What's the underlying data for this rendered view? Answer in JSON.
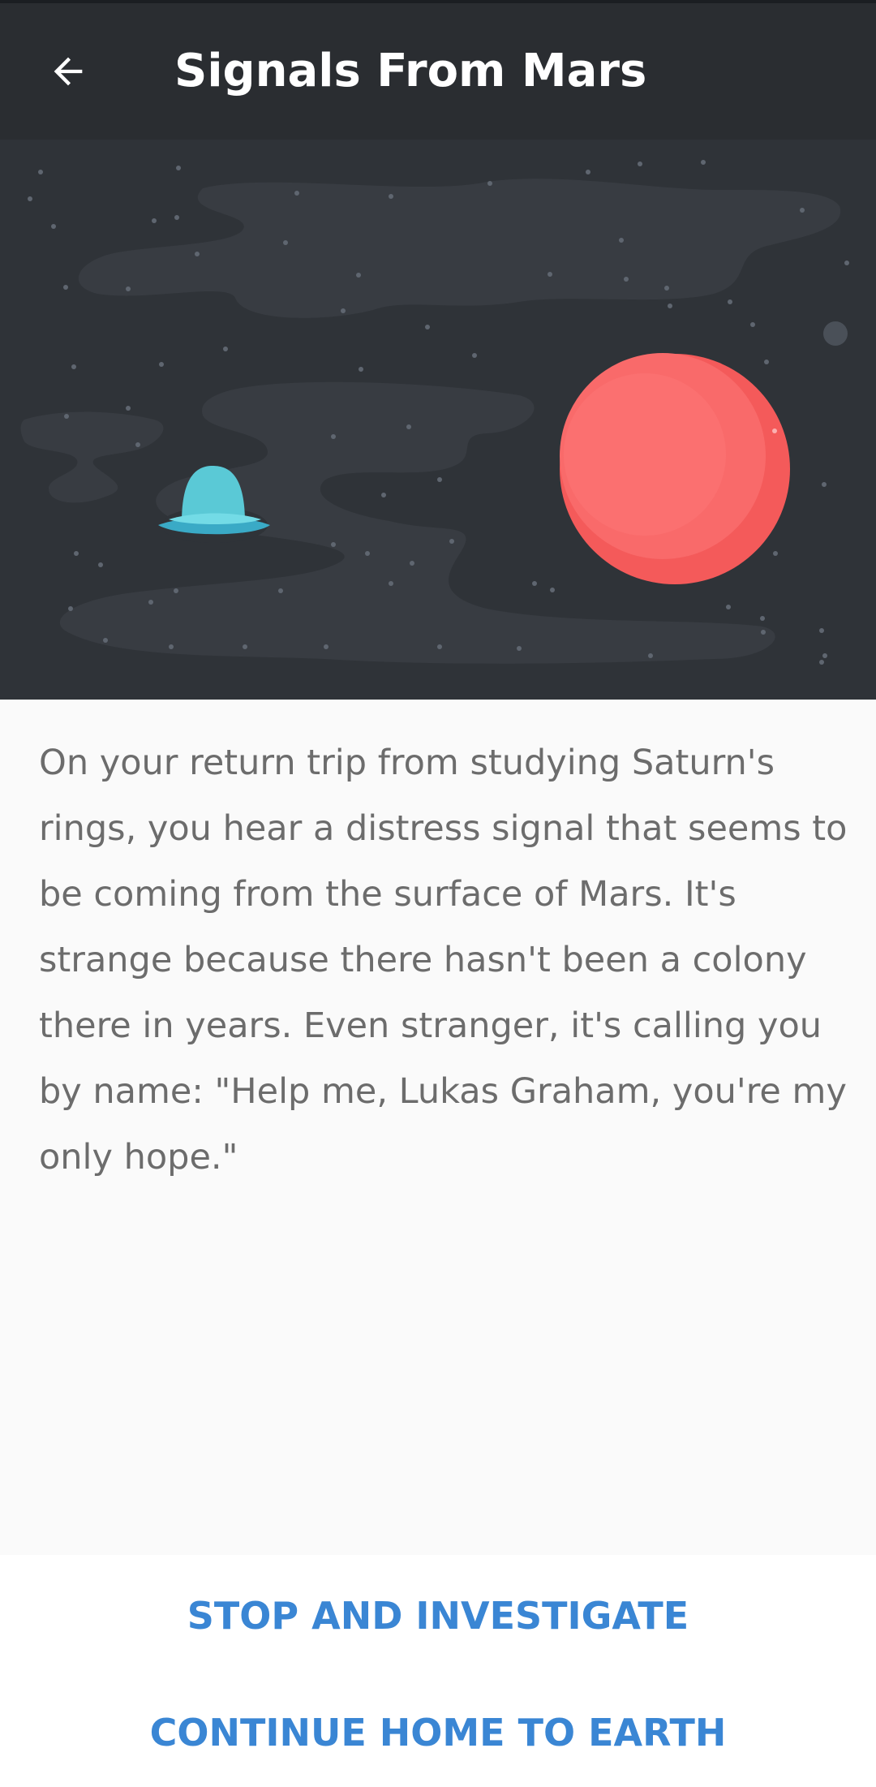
{
  "app_bar": {
    "title": "Signals From Mars",
    "back_icon": "arrow-left-icon"
  },
  "hero": {
    "illustration": "space scene with flying saucer and red planet",
    "colors": {
      "background": "#2f3338",
      "nebula": "#383c42",
      "stars": "#5f6670",
      "planet": "#f45a5a",
      "planet_highlight": "#f96a6a",
      "ufo_dome": "#5ac9d6",
      "ufo_disc": "#3aaac6"
    }
  },
  "story": {
    "text": "On your return trip from studying Saturn's rings, you hear a distress signal that seems to be coming from the surface of Mars. It's strange because there hasn't been a colony there in years. Even stranger, it's calling you by name: \"Help me, Lukas Graham, you're my only hope.\""
  },
  "choices": [
    {
      "label": "STOP AND INVESTIGATE"
    },
    {
      "label": "CONTINUE HOME TO EARTH"
    }
  ],
  "accent_color": "#3a86d4"
}
